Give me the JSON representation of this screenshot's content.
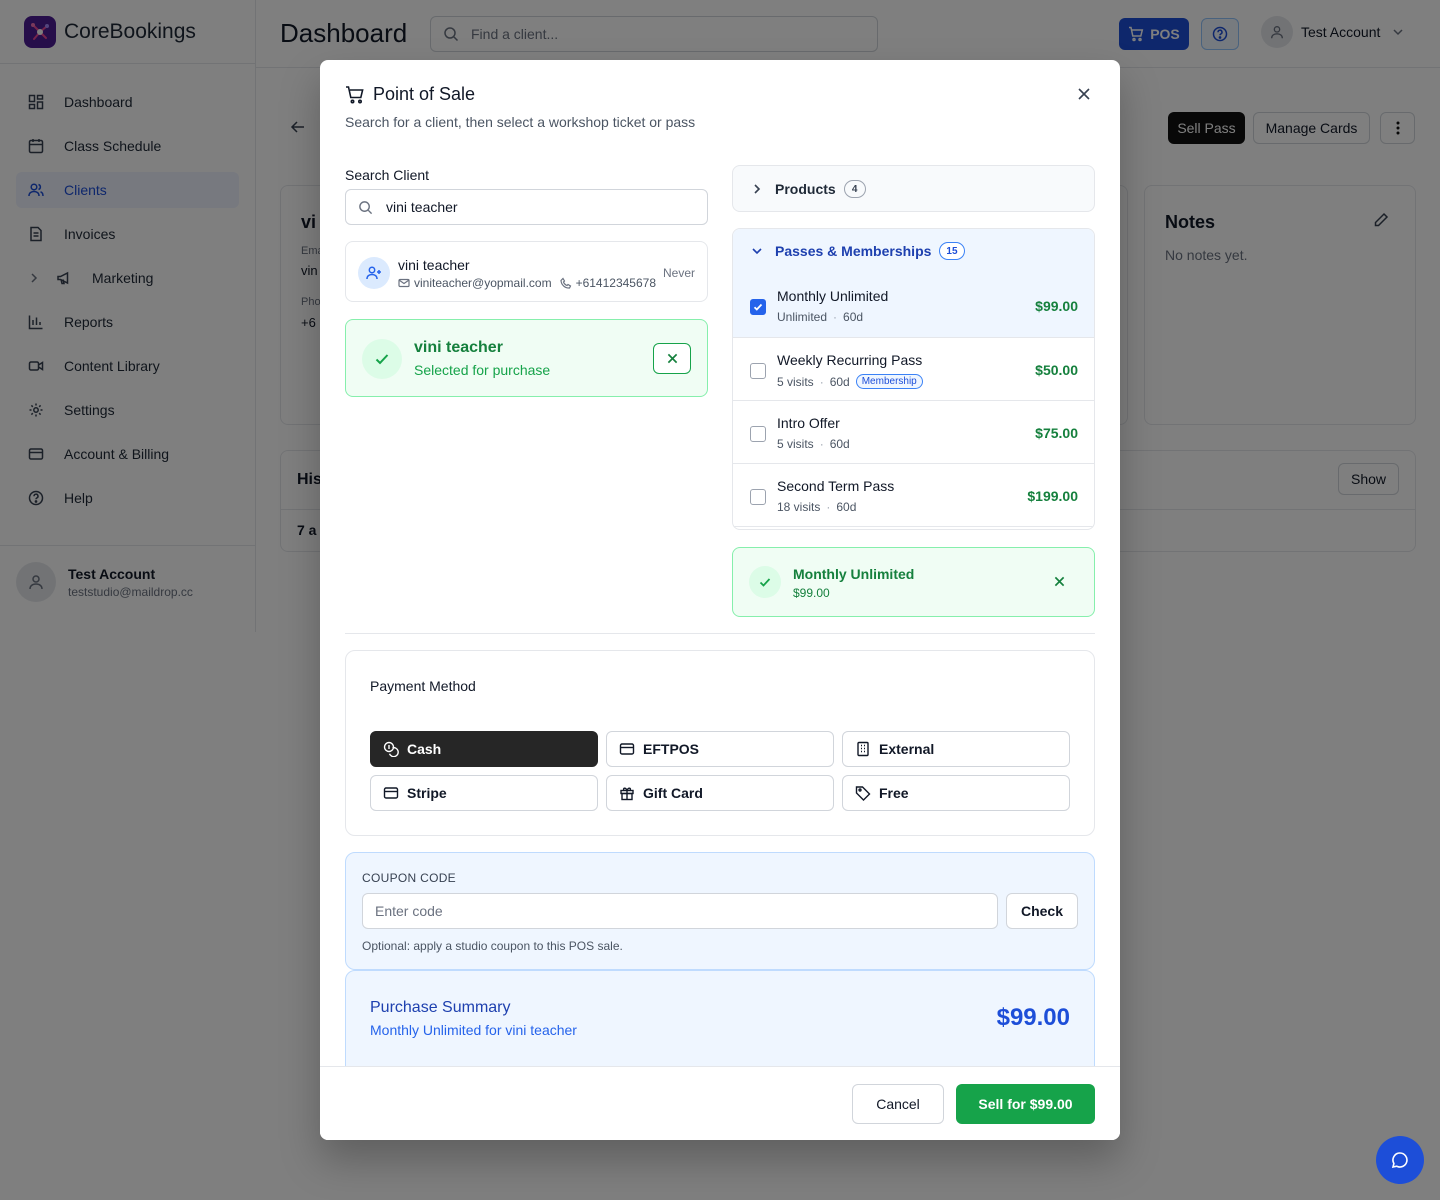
{
  "app": {
    "name": "CoreBookings",
    "page_title": "Dashboard"
  },
  "topbar": {
    "search_placeholder": "Find a client...",
    "pos_label": "POS",
    "user_name": "Test Account"
  },
  "sidebar": {
    "items": [
      {
        "label": "Dashboard",
        "icon": "dashboard-icon"
      },
      {
        "label": "Class Schedule",
        "icon": "calendar-icon"
      },
      {
        "label": "Clients",
        "icon": "users-icon",
        "active": true
      },
      {
        "label": "Invoices",
        "icon": "document-icon"
      },
      {
        "label": "Marketing",
        "icon": "megaphone-icon"
      },
      {
        "label": "Reports",
        "icon": "bar-chart-icon"
      },
      {
        "label": "Content Library",
        "icon": "video-icon"
      },
      {
        "label": "Settings",
        "icon": "gear-icon"
      },
      {
        "label": "Account & Billing",
        "icon": "credit-card-icon"
      },
      {
        "label": "Help",
        "icon": "help-icon"
      }
    ],
    "user": {
      "name": "Test Account",
      "email": "teststudio@maildrop.cc"
    }
  },
  "background": {
    "sell_pass": "Sell Pass",
    "manage_cards": "Manage Cards",
    "notes_title": "Notes",
    "notes_empty": "No notes yet.",
    "show_label": "Show",
    "card_title_partial": "vi",
    "email_label_partial": "Ema",
    "email_value_partial": "vin",
    "phone_label_partial": "Pho",
    "phone_value_partial": "+6",
    "history_partial": "His",
    "count_partial": "7 a"
  },
  "modal": {
    "title": "Point of Sale",
    "subtitle": "Search for a client, then select a workshop ticket or pass",
    "search_label": "Search Client",
    "search_value": "vini teacher",
    "client": {
      "name": "vini teacher",
      "email": "viniteacher@yopmail.com",
      "phone": "+61412345678",
      "last_visit": "Never"
    },
    "selected_client": {
      "name": "vini teacher",
      "status": "Selected for purchase"
    },
    "products": {
      "label": "Products",
      "count": "4"
    },
    "passes": {
      "label": "Passes & Memberships",
      "count": "15",
      "items": [
        {
          "name": "Monthly Unlimited",
          "visits": "Unlimited",
          "duration": "60d",
          "price": "$99.00",
          "checked": true,
          "badge": ""
        },
        {
          "name": "Weekly Recurring Pass",
          "visits": "5 visits",
          "duration": "60d",
          "price": "$50.00",
          "checked": false,
          "badge": "Membership"
        },
        {
          "name": "Intro Offer",
          "visits": "5 visits",
          "duration": "60d",
          "price": "$75.00",
          "checked": false,
          "badge": ""
        },
        {
          "name": "Second Term Pass",
          "visits": "18 visits",
          "duration": "60d",
          "price": "$199.00",
          "checked": false,
          "badge": ""
        }
      ]
    },
    "selected_pass": {
      "name": "Monthly Unlimited",
      "price": "$99.00"
    },
    "payment": {
      "title": "Payment Method",
      "methods": [
        {
          "label": "Cash",
          "icon": "coins-icon",
          "active": true
        },
        {
          "label": "EFTPOS",
          "icon": "credit-card-icon",
          "active": false
        },
        {
          "label": "External",
          "icon": "building-icon",
          "active": false
        },
        {
          "label": "Stripe",
          "icon": "credit-card-icon",
          "active": false
        },
        {
          "label": "Gift Card",
          "icon": "gift-icon",
          "active": false
        },
        {
          "label": "Free",
          "icon": "tag-icon",
          "active": false
        }
      ]
    },
    "coupon": {
      "label": "COUPON CODE",
      "placeholder": "Enter code",
      "check": "Check",
      "help": "Optional: apply a studio coupon to this POS sale."
    },
    "summary": {
      "title": "Purchase Summary",
      "detail": "Monthly Unlimited for vini teacher",
      "total": "$99.00"
    },
    "footer": {
      "cancel": "Cancel",
      "sell": "Sell for $99.00"
    }
  },
  "colors": {
    "primary": "#1d4ed8",
    "success": "#16a34a",
    "overlay": "rgba(0,0,0,0.5)",
    "dark": "#262626"
  }
}
